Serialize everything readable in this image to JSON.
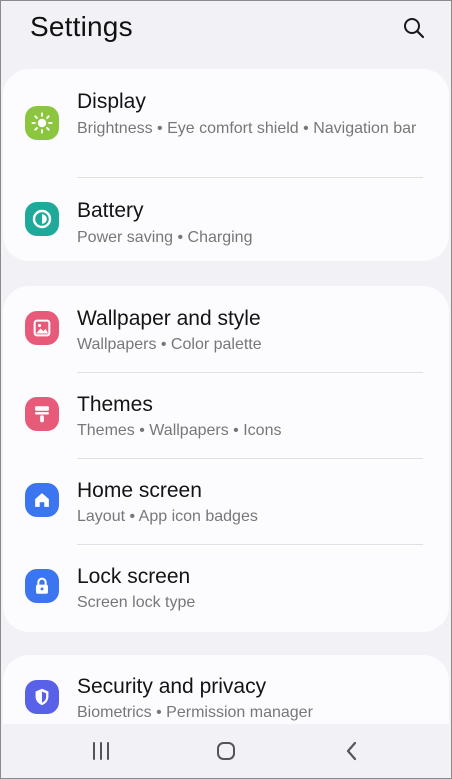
{
  "header": {
    "title": "Settings",
    "search_icon": "search-icon"
  },
  "cards": [
    {
      "items": [
        {
          "title": "Display",
          "subtitle": "Brightness • Eye comfort shield • Navigation bar",
          "icon": "sun-icon",
          "color": "#8cc63e"
        },
        {
          "title": "Battery",
          "subtitle": "Power saving • Charging",
          "icon": "battery-icon",
          "color": "#1fa99a"
        }
      ]
    },
    {
      "items": [
        {
          "title": "Wallpaper and style",
          "subtitle": "Wallpapers • Color palette",
          "icon": "image-icon",
          "color": "#e85a7a"
        },
        {
          "title": "Themes",
          "subtitle": "Themes • Wallpapers • Icons",
          "icon": "paintbrush-icon",
          "color": "#e85a7a"
        },
        {
          "title": "Home screen",
          "subtitle": "Layout • App icon badges",
          "icon": "home-icon",
          "color": "#3b76f0"
        },
        {
          "title": "Lock screen",
          "subtitle": "Screen lock type",
          "icon": "lock-icon",
          "color": "#3b76f0"
        }
      ]
    },
    {
      "items": [
        {
          "title": "Security and privacy",
          "subtitle": "Biometrics • Permission manager",
          "icon": "shield-icon",
          "color": "#5961e8"
        }
      ]
    }
  ],
  "navbar": {
    "recents_icon": "recents-icon",
    "home_icon": "home-nav-icon",
    "back_icon": "back-icon"
  },
  "colors": {
    "background": "#f2f1f6",
    "card": "#fcfcfe",
    "subtitle": "#777779"
  }
}
